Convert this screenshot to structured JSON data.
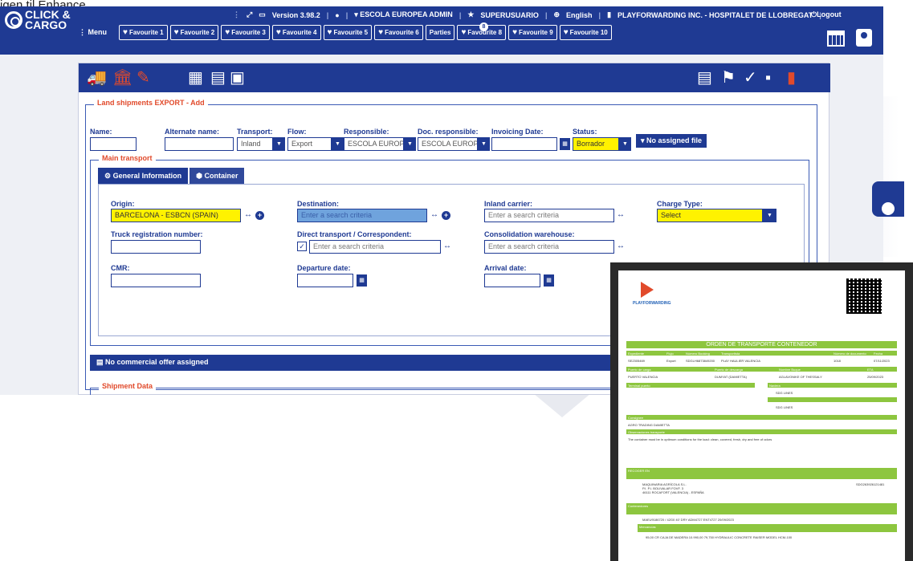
{
  "bg_text": "igen til Enhance",
  "logo": {
    "line1": "CLICK &",
    "line2": "CARGO"
  },
  "topbar": {
    "version": "Version 3.98.2",
    "user": "ESCOLA EUROPEA ADMIN",
    "role": "SUPERUSUARIO",
    "language": "English",
    "company": "PLAYFORWARDING INC. - HOSPITALET DE LLOBREGAT",
    "logout": "Logout",
    "menu": "Menu",
    "favourites": [
      "Favourite 1",
      "Favourite 2",
      "Favourite 3",
      "Favourite 4",
      "Favourite 5",
      "Favourite 6",
      "Parties",
      "Favourite 8",
      "Favourite 9",
      "Favourite 10"
    ],
    "parties_badge": "8"
  },
  "form": {
    "section_title": "Land shipments EXPORT - Add",
    "labels": {
      "name": "Name:",
      "alternate": "Alternate name:",
      "transport": "Transport:",
      "flow": "Flow:",
      "responsible": "Responsible:",
      "doc_responsible": "Doc. responsible:",
      "invoicing": "Invoicing Date:",
      "status": "Status:"
    },
    "values": {
      "transport": "Inland",
      "flow": "Export",
      "responsible": "ESCOLA EUROPEA",
      "doc_responsible": "ESCOLA EUROPEA",
      "status": "Borrador"
    },
    "no_file": "No assigned file",
    "main_transport": "Main transport",
    "tabs": [
      "General Information",
      "Container"
    ],
    "fields": {
      "origin": "Origin:",
      "origin_value": "BARCELONA - ESBCN (SPAIN)",
      "destination": "Destination:",
      "destination_ph": "Enter a search criteria",
      "inland_carrier": "Inland carrier:",
      "inland_ph": "Enter a search criteria",
      "charge_type": "Charge Type:",
      "charge_value": "Select",
      "truck": "Truck registration number:",
      "direct": "Direct transport / Correspondent:",
      "direct_ph": "Enter a search criteria",
      "consolidation": "Consolidation warehouse:",
      "consolidation_ph": "Enter a search criteria",
      "cmr": "CMR:",
      "departure": "Departure date:",
      "arrival": "Arrival date:"
    },
    "offer": "No commercial offer assigned",
    "shipment_data": "Shipment Data"
  },
  "doc": {
    "brand": "PLAYFORWARDING",
    "title": "ORDEN DE TRANSPORTE CONTENEDOR",
    "header_cols": [
      "Expediente",
      "Flujo",
      "Número Booking",
      "Transportista",
      "Número de documento",
      "Fecha"
    ],
    "header_vals": [
      "SE2305469",
      "Export",
      "SDGLH6873849200",
      "PLAY HAULIER VALENCIA",
      "1018",
      "07/11/2023"
    ],
    "row2_cols": [
      "Puerto de carga",
      "Puerto de descarga",
      "Nombre Buque",
      "ETA"
    ],
    "row2_vals": [
      "PUERTO VALENCIA",
      "DUMYAT (DAMIETTA)",
      "AGLAVONIKE OF THESSALY",
      "25/09/2023"
    ],
    "terminal": "Terminal puerto",
    "naviera": "Naviera",
    "naviera_val": "SDG LINES",
    "consignee": "Consignee",
    "consignee_val": "AGRO TRADING DAMIETTA",
    "obs": "Observaciones transporte",
    "obs_val": "The container must be in optimum conditions for the load: clean, covered, fresh, dry and free of odors",
    "recoger": "RECOGER EN",
    "recoger_val1": "MAQUINARIA AGRÍCOLA S.L.",
    "recoger_val2": "P.I. P.I. BOLIVALAR FOVF. 3",
    "recoger_val3": "46111 ROCAFORT (VALENCIA) - ESPAÑA",
    "recoger_ref": "SDG263926121481",
    "contenedores": "Contenedores",
    "cont_val": "MAEU9186720 / 42G0 40' DRY  ADM4727  ENT4727  20/09/2023",
    "mercancias": "Mercancías",
    "merc_val": "95,00 CR CAJA DE MADERA   10.990,00   79,750 HYDRAULIC CONCRETE RAISER MODEL HCM-100"
  }
}
